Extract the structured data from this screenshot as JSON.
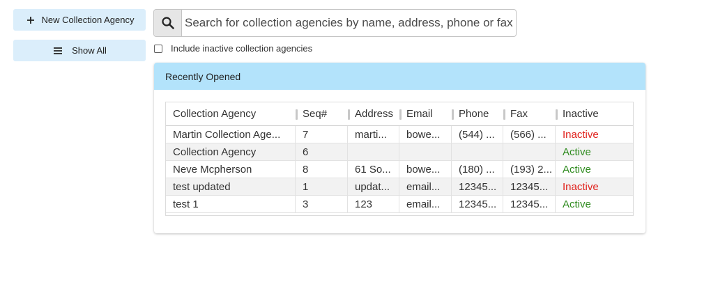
{
  "sidebar": {
    "new_button": {
      "label": "New Collection Agency",
      "icon": "plus-icon"
    },
    "show_all_button": {
      "label": "Show All",
      "icon": "menu-icon"
    }
  },
  "search": {
    "placeholder": "Search for collection agencies by name, address, phone or fax",
    "value": "",
    "icon": "search-icon"
  },
  "include_inactive": {
    "label": "Include inactive collection agencies",
    "checked": false
  },
  "recent_panel": {
    "title": "Recently Opened",
    "columns": [
      "Collection Agency",
      "Seq#",
      "Address",
      "Email",
      "Phone",
      "Fax",
      "Inactive"
    ],
    "rows": [
      {
        "agency": "Martin Collection Age...",
        "seq": "7",
        "address": "marti...",
        "email": "bowe...",
        "phone": "(544) ...",
        "fax": "(566) ...",
        "status": "Inactive"
      },
      {
        "agency": "Collection Agency",
        "seq": "6",
        "address": "",
        "email": "",
        "phone": "",
        "fax": "",
        "status": "Active"
      },
      {
        "agency": "Neve Mcpherson",
        "seq": "8",
        "address": "61 So...",
        "email": "bowe...",
        "phone": "(180) ...",
        "fax": "(193) 2...",
        "status": "Active"
      },
      {
        "agency": "test updated",
        "seq": "1",
        "address": "updat...",
        "email": "email...",
        "phone": "12345...",
        "fax": "12345...",
        "status": "Inactive"
      },
      {
        "agency": "test 1",
        "seq": "3",
        "address": "123",
        "email": "email...",
        "phone": "12345...",
        "fax": "12345...",
        "status": "Active"
      }
    ]
  },
  "colors": {
    "button_bg": "#dbeefb",
    "panel_header_bg": "#b3e3fb",
    "active": "#2e8b1e",
    "inactive": "#e0201b"
  }
}
